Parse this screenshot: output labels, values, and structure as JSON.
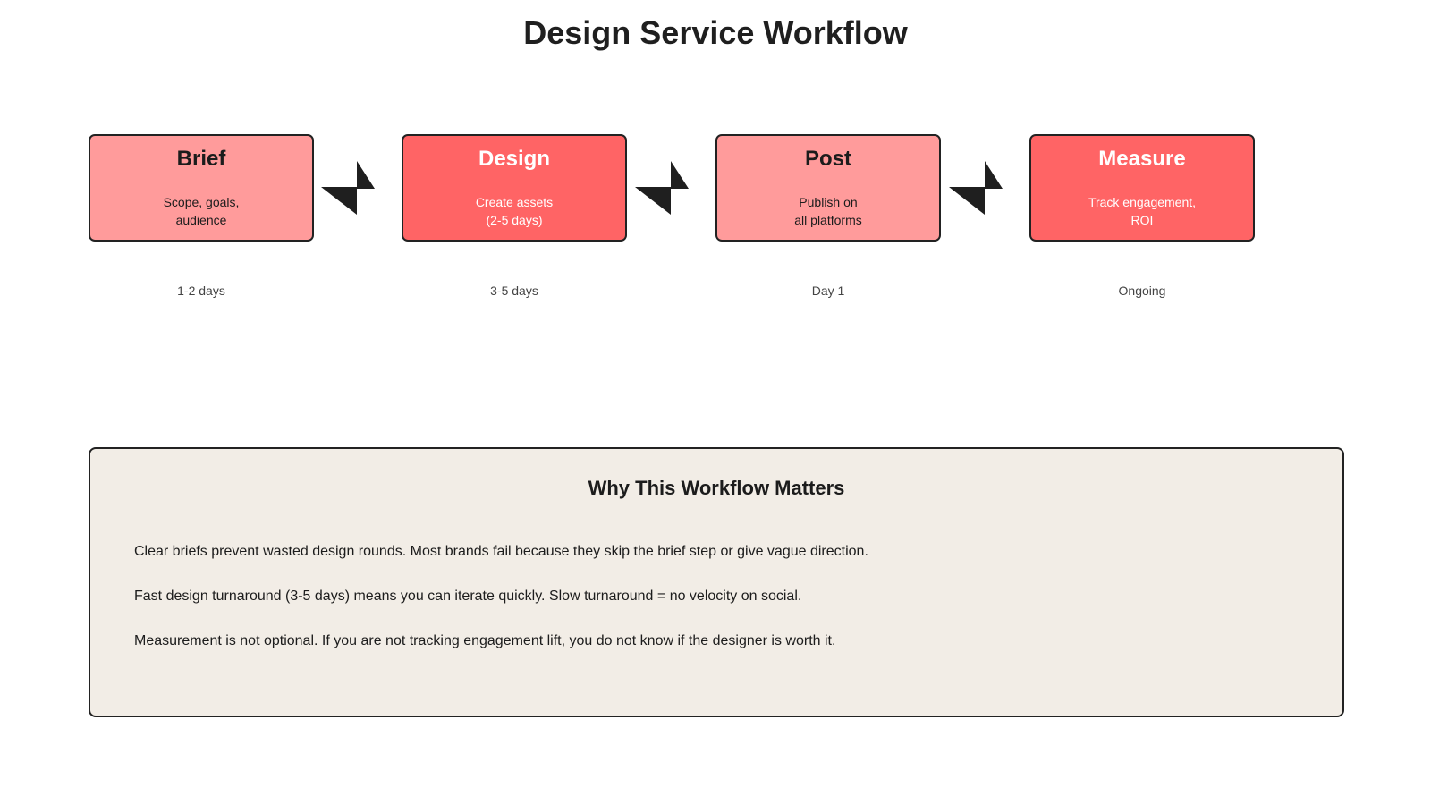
{
  "title": "Design Service Workflow",
  "steps": [
    {
      "title": "Brief",
      "description": "Scope, goals,\naudience",
      "duration": "1-2 days",
      "fill": "#ff9b9b"
    },
    {
      "title": "Design",
      "description": "Create assets\n(2-5 days)",
      "duration": "3-5 days",
      "fill": "#ff6465"
    },
    {
      "title": "Post",
      "description": "Publish on\nall platforms",
      "duration": "Day 1",
      "fill": "#ff9b9b"
    },
    {
      "title": "Measure",
      "description": "Track engagement,\nROI",
      "duration": "Ongoing",
      "fill": "#ff6465"
    }
  ],
  "connector_icon": "arrow-icon",
  "panel": {
    "title": "Why This Workflow Matters",
    "points": [
      "Clear briefs prevent wasted design rounds. Most brands fail because they skip the brief step or give vague direction.",
      "Fast design turnaround (3-5 days) means you can iterate quickly. Slow turnaround = no velocity on social.",
      "Measurement is not optional. If you are not tracking engagement lift, you do not know if the designer is worth it."
    ],
    "background": "#f2ede6"
  }
}
